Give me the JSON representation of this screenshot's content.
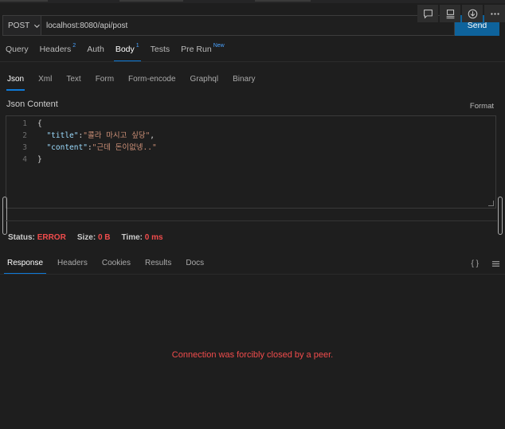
{
  "request": {
    "method": "POST",
    "url": "localhost:8080/api/post",
    "send_label": "Send"
  },
  "request_tabs": [
    {
      "label": "Query",
      "badge": ""
    },
    {
      "label": "Headers",
      "badge": "2"
    },
    {
      "label": "Auth",
      "badge": ""
    },
    {
      "label": "Body",
      "badge": "1",
      "active": true
    },
    {
      "label": "Tests",
      "badge": ""
    },
    {
      "label": "Pre Run",
      "badge": "New"
    }
  ],
  "body_tabs": [
    {
      "label": "Json",
      "active": true
    },
    {
      "label": "Xml"
    },
    {
      "label": "Text"
    },
    {
      "label": "Form"
    },
    {
      "label": "Form-encode"
    },
    {
      "label": "Graphql"
    },
    {
      "label": "Binary"
    }
  ],
  "editor": {
    "title": "Json Content",
    "format_label": "Format",
    "line_numbers": [
      "1",
      "2",
      "3",
      "4"
    ],
    "lines": [
      {
        "parts": [
          {
            "t": "p",
            "v": "{"
          }
        ]
      },
      {
        "parts": [
          {
            "t": "p",
            "v": "  "
          },
          {
            "t": "k",
            "v": "\"title\""
          },
          {
            "t": "p",
            "v": ":"
          },
          {
            "t": "s",
            "v": "\"콜라 마시고 싶당\""
          },
          {
            "t": "p",
            "v": ","
          }
        ]
      },
      {
        "parts": [
          {
            "t": "p",
            "v": "  "
          },
          {
            "t": "k",
            "v": "\"content\""
          },
          {
            "t": "p",
            "v": ":"
          },
          {
            "t": "s",
            "v": "\"근데 돈이없넹..\""
          }
        ]
      },
      {
        "parts": [
          {
            "t": "p",
            "v": "}"
          }
        ]
      }
    ]
  },
  "status": {
    "status_label": "Status:",
    "status_value": "ERROR",
    "size_label": "Size:",
    "size_value": "0 B",
    "time_label": "Time:",
    "time_value": "0 ms"
  },
  "response_tabs": [
    {
      "label": "Response",
      "active": true
    },
    {
      "label": "Headers"
    },
    {
      "label": "Cookies"
    },
    {
      "label": "Results"
    },
    {
      "label": "Docs"
    }
  ],
  "response_icons": {
    "braces": "{ }",
    "menu": "menu-icon"
  },
  "error_message": "Connection was forcibly closed by a peer.",
  "colors": {
    "accent": "#0e639c",
    "tab_underline": "#0e7ad8",
    "error": "#f14c4c",
    "json_key": "#9cdcfe",
    "json_string": "#ce9178"
  },
  "icons": [
    "comment-icon",
    "layout-icon",
    "download-icon",
    "more-icon",
    "chevron-down-icon"
  ]
}
